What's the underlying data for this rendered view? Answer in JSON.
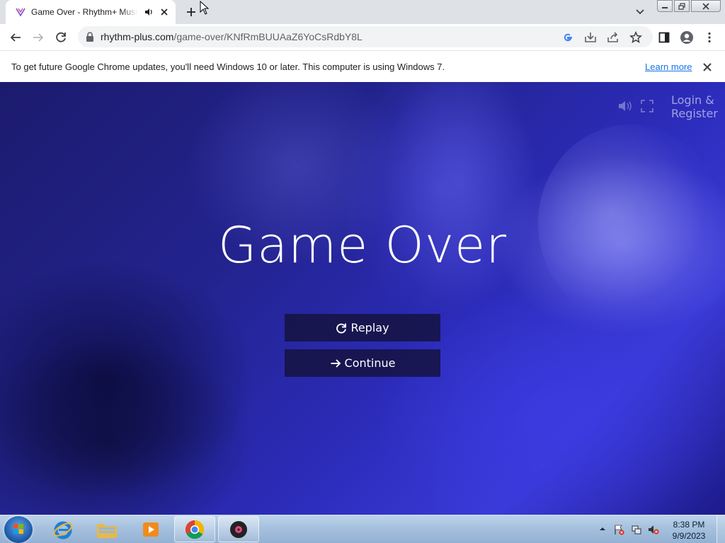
{
  "browser": {
    "tab_title": "Game Over - Rhythm+ Music Game",
    "url_host": "rhythm-plus.com",
    "url_path": "/game-over/KNfRmBUUAaZ6YoCsRdbY8L"
  },
  "infobar": {
    "message": "To get future Google Chrome updates, you'll need Windows 10 or later. This computer is using Windows 7.",
    "link_label": "Learn more"
  },
  "page": {
    "login_label": "Login & Register",
    "title": "Game Over",
    "replay_label": "Replay",
    "continue_label": "Continue"
  },
  "taskbar": {
    "time": "8:38 PM",
    "date": "9/9/2023",
    "apps": [
      "internet-explorer",
      "file-explorer",
      "media-player",
      "chrome",
      "music-app"
    ]
  },
  "colors": {
    "accent_link": "#1a73e8",
    "page_bg": "#2b2bb8",
    "button_bg": "#14123c"
  }
}
